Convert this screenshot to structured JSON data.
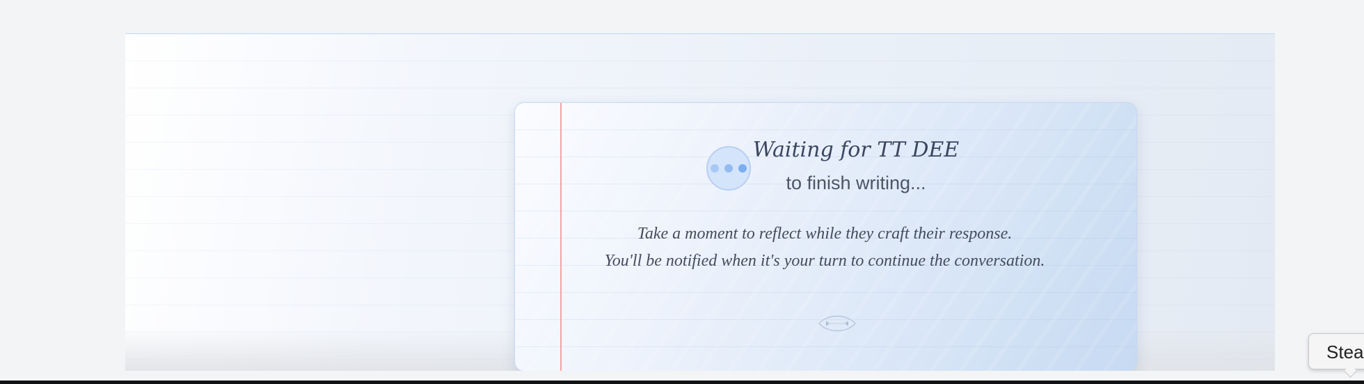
{
  "waiting_card": {
    "title": "Waiting for TT DEE",
    "subtitle": "to finish writing...",
    "message_line_1": "Take a moment to reflect while they craft their response.",
    "message_line_2": "You'll be notified when it's your turn to continue the conversation.",
    "typing_indicator_icon": "typing-dots-icon",
    "ornament_icon": "leaf-ornament-icon"
  },
  "tooltip": {
    "label": "Stea"
  },
  "colors": {
    "accent": "#7aaef0",
    "margin_rule": "#f0a5a5",
    "card_border": "#c4d8f1",
    "text_primary": "#3a4660"
  }
}
